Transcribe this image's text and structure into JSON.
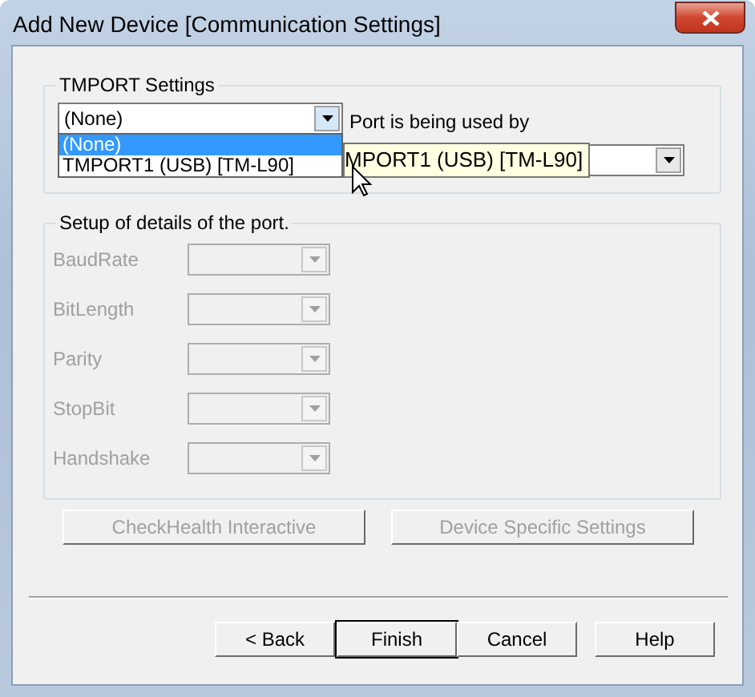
{
  "window": {
    "title": "Add New Device  [Communication Settings]"
  },
  "tmport_settings": {
    "legend": "TMPORT Settings",
    "port_combo": {
      "value": "(None)",
      "expanded": true
    },
    "options": [
      {
        "label": "(None)",
        "selected": true
      },
      {
        "label": "TMPORT1 (USB) [TM-L90]",
        "selected": false
      }
    ],
    "used_by_label": "Port is being used by",
    "used_by_tooltip": "MPORT1 (USB) [TM-L90]"
  },
  "port_details": {
    "legend": "Setup of details of the port.",
    "fields": [
      {
        "label": "BaudRate",
        "disabled": true
      },
      {
        "label": "BitLength",
        "disabled": true
      },
      {
        "label": "Parity",
        "disabled": true
      },
      {
        "label": "StopBit",
        "disabled": true
      },
      {
        "label": "Handshake",
        "disabled": true
      }
    ]
  },
  "action_buttons": [
    {
      "label": "CheckHealth Interactive",
      "disabled": true
    },
    {
      "label": "Device Specific Settings",
      "disabled": true
    }
  ],
  "footer_buttons": [
    {
      "label": "< Back",
      "default": false
    },
    {
      "label": "Finish",
      "default": true
    },
    {
      "label": "Cancel",
      "default": false
    },
    {
      "label": "Help",
      "default": false
    }
  ]
}
